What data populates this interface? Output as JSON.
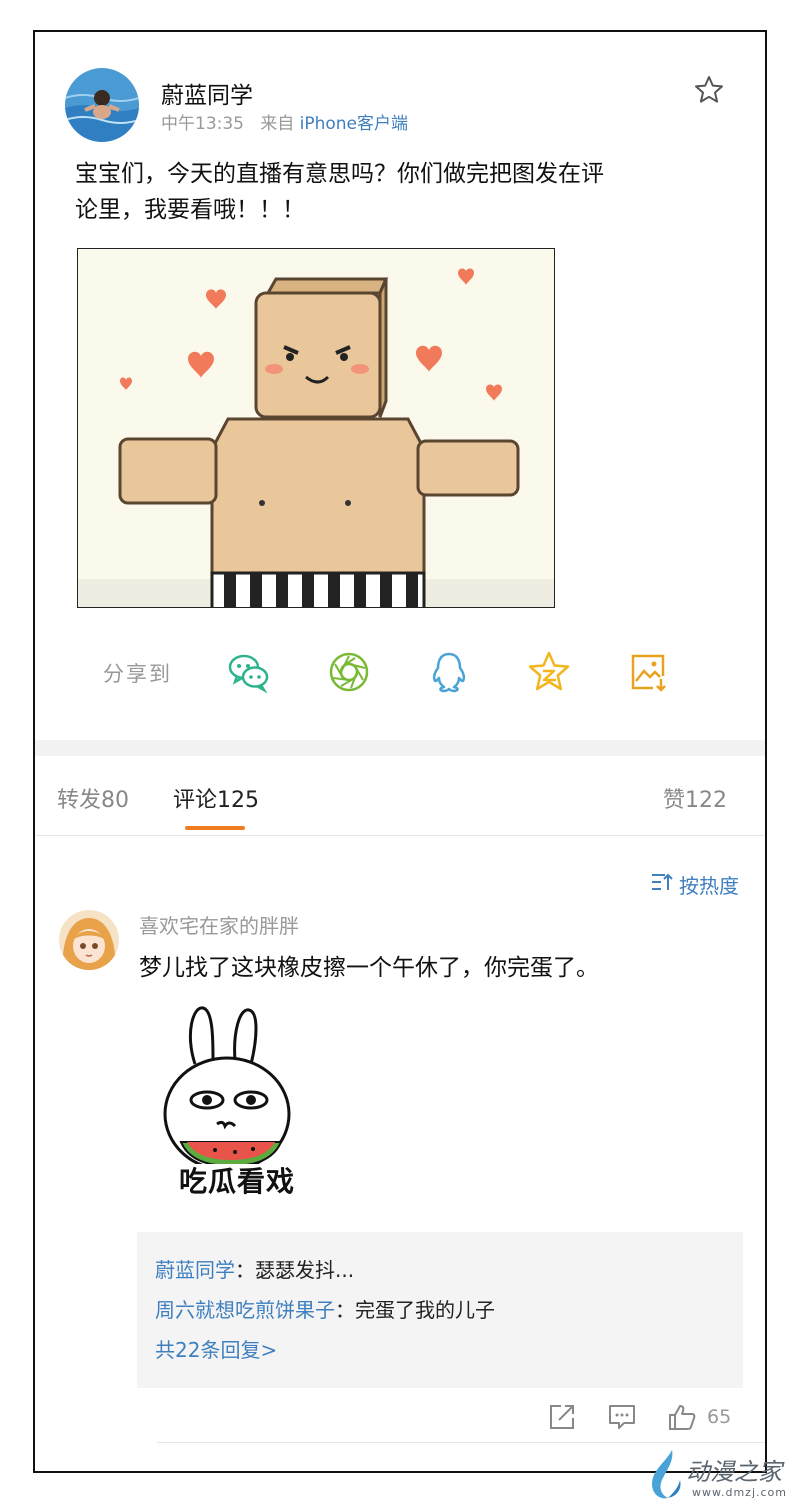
{
  "post": {
    "author": "蔚蓝同学",
    "time": "中午13:35",
    "from_prefix": "来自",
    "client": "iPhone客户端",
    "text_line1": "宝宝们，今天的直播有意思吗？你们做完把图发在评",
    "text_line2": "论里，我要看哦！！！"
  },
  "share": {
    "label": "分享到",
    "icons": [
      "wechat-icon",
      "moments-icon",
      "qq-icon",
      "qzone-icon",
      "save-image-icon"
    ],
    "colors": {
      "wechat": "#2fb38e",
      "moments": "#7ab933",
      "qq": "#4aa3d8",
      "qzone": "#f2b51c",
      "save": "#e9a21f"
    }
  },
  "tabs": {
    "repost": "转发80",
    "comment": "评论125",
    "like": "赞122"
  },
  "comments": {
    "sort_label": "按热度",
    "items": [
      {
        "author": "喜欢宅在家的胖胖",
        "text": "梦儿找了这块橡皮擦一个午休了，你完蛋了。",
        "sticker_caption": "吃瓜看戏",
        "replies": [
          {
            "name": "蔚蓝同学",
            "text": "：瑟瑟发抖..."
          },
          {
            "name": "周六就想吃煎饼果子",
            "text": "：完蛋了我的儿子"
          }
        ],
        "more_replies": "共22条回复>",
        "like_count": "65"
      }
    ]
  },
  "watermark": {
    "text": "动漫之家",
    "url": "www.dmzj.com"
  },
  "colors": {
    "link": "#3f7fbf",
    "tab_accent": "#f07d21"
  }
}
